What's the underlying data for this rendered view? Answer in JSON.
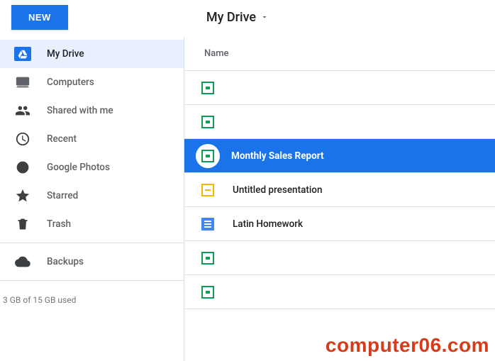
{
  "topbar": {
    "new_label": "NEW"
  },
  "breadcrumb": {
    "title": "My Drive"
  },
  "sidebar": {
    "items": [
      {
        "key": "my-drive",
        "label": "My Drive",
        "icon": "drive",
        "active": true
      },
      {
        "key": "computers",
        "label": "Computers",
        "icon": "computer"
      },
      {
        "key": "shared",
        "label": "Shared with me",
        "icon": "people"
      },
      {
        "key": "recent",
        "label": "Recent",
        "icon": "clock"
      },
      {
        "key": "photos",
        "label": "Google Photos",
        "icon": "photos"
      },
      {
        "key": "starred",
        "label": "Starred",
        "icon": "star"
      },
      {
        "key": "trash",
        "label": "Trash",
        "icon": "trash"
      }
    ],
    "backups_label": "Backups",
    "storage_text": "3 GB of 15 GB used"
  },
  "main": {
    "column_header": "Name",
    "files": [
      {
        "type": "sheet",
        "name": "",
        "selected": false
      },
      {
        "type": "sheet",
        "name": "",
        "selected": false
      },
      {
        "type": "sheet",
        "name": "Monthly Sales Report",
        "selected": true
      },
      {
        "type": "slides",
        "name": "Untitled presentation",
        "selected": false
      },
      {
        "type": "docs",
        "name": "Latin Homework",
        "selected": false
      },
      {
        "type": "sheet",
        "name": "",
        "selected": false
      },
      {
        "type": "sheet",
        "name": "",
        "selected": false
      }
    ]
  },
  "watermark": "computer06.com"
}
